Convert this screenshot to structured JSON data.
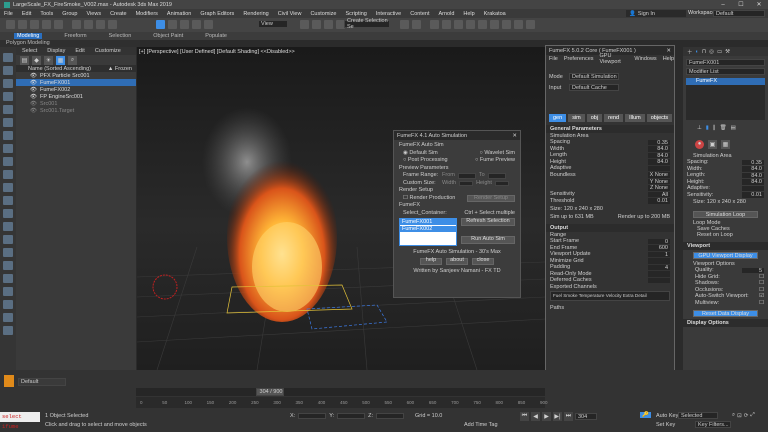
{
  "window": {
    "title": "LargeScale_FX_FireSmoke_V002.max - Autodesk 3ds Max 2019",
    "signin": "Sign In",
    "workspaces_label": "Workspaces:",
    "workspaces_value": "Default"
  },
  "menu": [
    "File",
    "Edit",
    "Tools",
    "Group",
    "Views",
    "Create",
    "Modifiers",
    "Animation",
    "Graph Editors",
    "Rendering",
    "Civil View",
    "Customize",
    "Scripting",
    "Interactive",
    "Content",
    "Arnold",
    "Help",
    "Krakatoa"
  ],
  "ribbon_tabs": [
    "Modeling",
    "Freeform",
    "Selection",
    "Object Paint",
    "Populate"
  ],
  "ribbon_sub": "Polygon Modeling",
  "toolbar": {
    "view_dropdown": "View",
    "selection_set": "Create Selection Se"
  },
  "scene_explorer": {
    "menu": [
      "Select",
      "Display",
      "Edit",
      "Customize"
    ],
    "header_name": "Name (Sorted Ascending)",
    "header_frozen": "▲ Frozen",
    "items": [
      "PFX Particle Src001",
      "FumeFX001",
      "FumeFX002",
      "FP EngineSrc001",
      "Src001",
      "Src001.Target"
    ]
  },
  "viewport": {
    "label": "[+] [Perspective] [User Defined] [Default Shading] <<Disabled>>"
  },
  "auto_sim": {
    "title": "FumeFX 4.1 Auto Simulation",
    "section_auto": "FumeFX Auto Sim",
    "default_sim": "Default Sim",
    "wavelet_sim": "Wavelet Sim",
    "post_processing": "Post Processing",
    "fume_preview": "Fume Preview",
    "section_preview": "Preview Parameters",
    "frame_range": "Frame Range:",
    "custom_size": "Custom Size:",
    "from": "From",
    "to": "To",
    "width": "Width",
    "height": "Height",
    "section_render": "Render Setup",
    "render_production": "Render Production",
    "render_setup_btn": "Render Setup",
    "section_fumefx": "FumeFX",
    "select_container": "Select_Container:",
    "ctrl_hint": "Ctrl + Select multiple",
    "containers": [
      "FumeFX001",
      "FumeFX002"
    ],
    "refresh_btn": "Refresh Selection",
    "run_btn": "Run Auto Sim",
    "version": "FumeFX Auto Simulation - 30's Max",
    "help_btn": "help",
    "about_btn": "about",
    "close_btn": "close",
    "author": "Written by Sanjeev Namani - FX TD"
  },
  "fume_panel": {
    "title": "FumeFX 5.0.2 Core ( FumeFX001 )",
    "menu": [
      "File",
      "Preferences",
      "GPU Viewport",
      "Windows",
      "Help"
    ],
    "mode_label": "Mode",
    "mode_value": "Default Simulation",
    "input_label": "Input",
    "input_value": "Default Cache",
    "tabs": [
      "gen",
      "sim",
      "obj",
      "rend",
      "Illum",
      "objects"
    ],
    "general_params": "General Parameters",
    "sim_area": "Simulation Area",
    "params": [
      {
        "k": "Spacing",
        "v": "0.35"
      },
      {
        "k": "Width",
        "v": "84.0"
      },
      {
        "k": "Length",
        "v": "84.0"
      },
      {
        "k": "Height",
        "v": "84.0"
      },
      {
        "k": "Adaptive",
        "v": ""
      },
      {
        "k": "Boundless",
        "v": "X None"
      },
      {
        "k": "",
        "v": "Y None"
      },
      {
        "k": "",
        "v": "Z None"
      },
      {
        "k": "Sensitivity",
        "v": "All Fields"
      },
      {
        "k": "Threshold",
        "v": "0.01"
      }
    ],
    "size": "Size: 120 x 240 x 280",
    "mem_sim": "Sim up to 631 MB",
    "mem_render": "Render up to 200 MB",
    "output": "Output",
    "range": "Range",
    "out_params": [
      {
        "k": "Start Frame",
        "v": "0"
      },
      {
        "k": "End Frame",
        "v": "600"
      },
      {
        "k": "Viewport Update",
        "v": "1"
      },
      {
        "k": "Minimize Grid",
        "v": ""
      },
      {
        "k": "Padding",
        "v": "4"
      },
      {
        "k": "Read-Only Mode",
        "v": ""
      },
      {
        "k": "Deferred Caches",
        "v": ""
      }
    ],
    "exported": "Exported Channels",
    "channels": "Fuel Smoke Temperature Velocity Extra Detail",
    "paths": "Paths"
  },
  "command_panel": {
    "object_name": "FumeFX001",
    "modifier_list": "Modifier List",
    "stack_item": "FumeFX",
    "sim_area": "Simulation Area",
    "params": [
      {
        "k": "Spacing:",
        "v": "0.35"
      },
      {
        "k": "Width:",
        "v": "84.0"
      },
      {
        "k": "Length:",
        "v": "84.0"
      },
      {
        "k": "Height:",
        "v": "84.0"
      },
      {
        "k": "Adaptive:",
        "v": ""
      },
      {
        "k": "Sensitivity:",
        "v": "0.01"
      }
    ],
    "size": "Size: 120 x 240 x 280",
    "sim_loop_btn": "Simulation Loop",
    "loop_mode": "Loop Mode",
    "save_cache": "Save Caches",
    "reset_loop": "Reset on Loop",
    "viewport_section": "Viewport",
    "gpu_btn": "GPU Viewport Display",
    "vp_options": "Viewport Options",
    "quality": "Quality:",
    "quality_v": "5",
    "hide_grid": "Hide Grid:",
    "shadows": "Shadows:",
    "occlusions": "Occlusions:",
    "autoswitch": "Auto-Switch Viewport:",
    "multiview": "Multiview:",
    "reset_data": "Reset Data Display",
    "display_section": "Display Options"
  },
  "bottom": {
    "workspace": "Default",
    "frame": "304 / 900",
    "selected": "1 Object Selected",
    "hint": "Click and drag to select and move objects",
    "maxscript": "select 1fume",
    "x": "X:",
    "y": "Y:",
    "z": "Z:",
    "grid": "Grid = 10.0",
    "add_time_tag": "Add Time Tag",
    "auto_key": "Auto Key",
    "set_key": "Set Key",
    "selected_dd": "Selected",
    "key_filters": "Key Filters...",
    "frame_num": "304",
    "ticks": [
      "0",
      "50",
      "100",
      "150",
      "200",
      "250",
      "300",
      "350",
      "400",
      "450",
      "500",
      "550",
      "600",
      "650",
      "700",
      "750",
      "800",
      "850",
      "900"
    ]
  },
  "colors": {
    "accent": "#3d8ee6",
    "selection": "#2f6db5",
    "fire": "#f28a1e"
  }
}
